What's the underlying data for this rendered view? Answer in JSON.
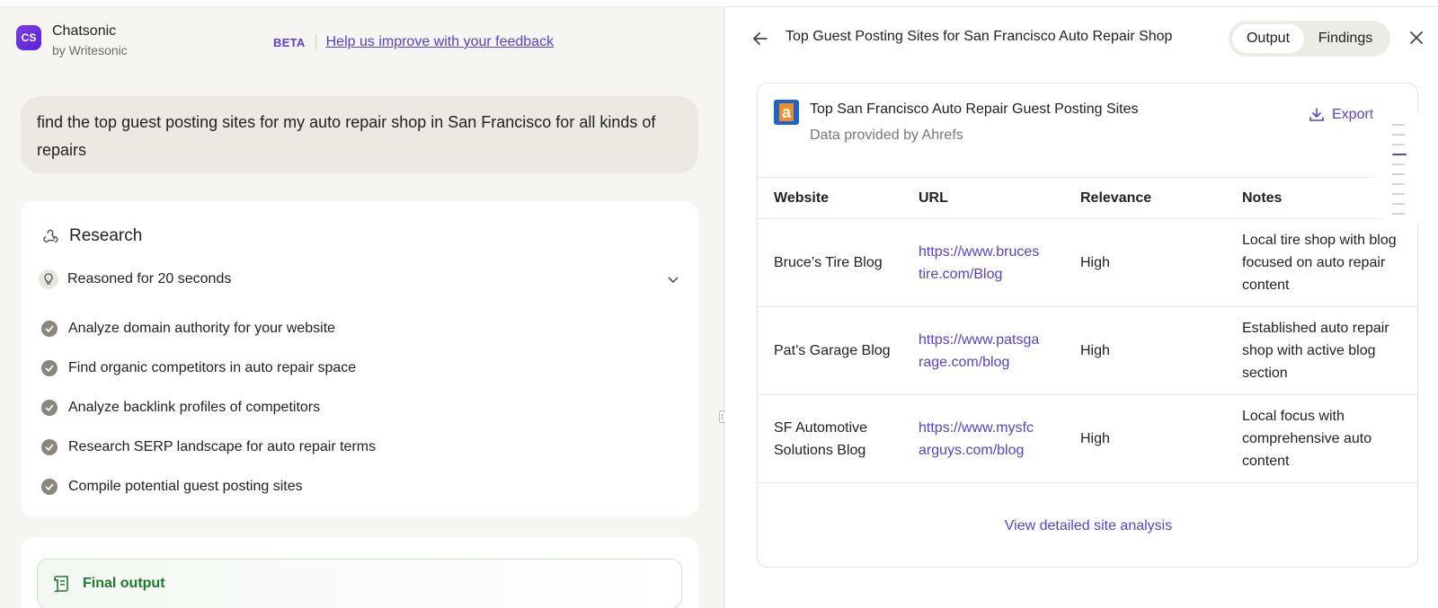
{
  "app": {
    "logo_text": "CS",
    "name": "Chatsonic",
    "sub": "by Writesonic",
    "beta": "BETA",
    "feedback_link": "Help us improve with your feedback"
  },
  "prompt": "find the top guest posting sites for my auto repair shop in San Francisco for all kinds of repairs",
  "research": {
    "title": "Research",
    "reasoned": "Reasoned for 20 seconds",
    "steps": [
      "Analyze domain authority for your website",
      "Find organic competitors in auto repair space",
      "Analyze backlink profiles of competitors",
      "Research SERP landscape for auto repair terms",
      "Compile potential guest posting sites"
    ]
  },
  "final_output": "Final output",
  "panel": {
    "title": "Top Guest Posting Sites for San Francisco Auto Repair Shop",
    "tabs": [
      "Output",
      "Findings"
    ],
    "active_tab": "Output"
  },
  "card": {
    "logo_text": "a",
    "title": "Top San Francisco Auto Repair Guest Posting Sites",
    "subtitle": "Data provided by Ahrefs",
    "export": "Export",
    "columns": [
      "Website",
      "URL",
      "Relevance",
      "Notes"
    ],
    "rows": [
      {
        "website": "Bruce’s Tire Blog",
        "url1": "https://www.bruces",
        "url2": "tire.com/Blog",
        "relevance": "High",
        "notes": "Local tire shop with blog focused on auto repair content"
      },
      {
        "website": "Pat’s Garage Blog",
        "url1": "https://www.patsga",
        "url2": "rage.com/blog",
        "relevance": "High",
        "notes": "Established auto repair shop with active blog section"
      },
      {
        "website": "SF Automotive Solutions Blog",
        "url1": "https://www.mysfc",
        "url2": "arguys.com/blog",
        "relevance": "High",
        "notes": "Local focus with comprehensive auto content"
      }
    ],
    "view_link": "View detailed site analysis"
  },
  "colors": {
    "accent": "#5a3fd0",
    "success": "#1f7a2e",
    "left_bg": "#f6f5f1"
  }
}
